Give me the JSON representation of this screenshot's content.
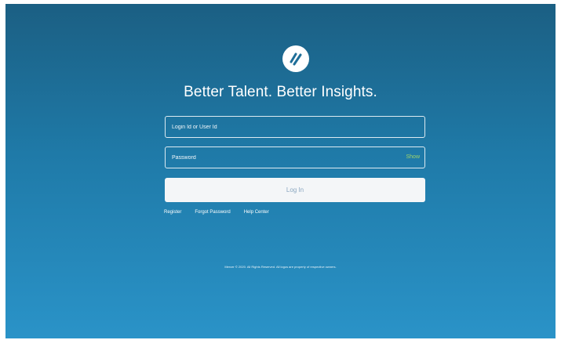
{
  "brand": {
    "logo_icon": "slash-circle-logo-icon",
    "tagline": "Better Talent. Better Insights."
  },
  "form": {
    "login_placeholder": "Login Id or User Id",
    "password_placeholder": "Password",
    "show_label": "Show",
    "login_button": "Log In"
  },
  "links": {
    "register": "Register",
    "forgot_password": "Forgot Password",
    "help_center": "Help Center"
  },
  "footer": {
    "text": "Mercer © 2020. All Rights Reserved. All logos are property of respective owners."
  },
  "colors": {
    "background_top": "#1b5f83",
    "background_bottom": "#2a93c8",
    "show_toggle": "#9fd36a",
    "button_bg": "#f4f6f8",
    "button_text": "#8aa7c0"
  }
}
